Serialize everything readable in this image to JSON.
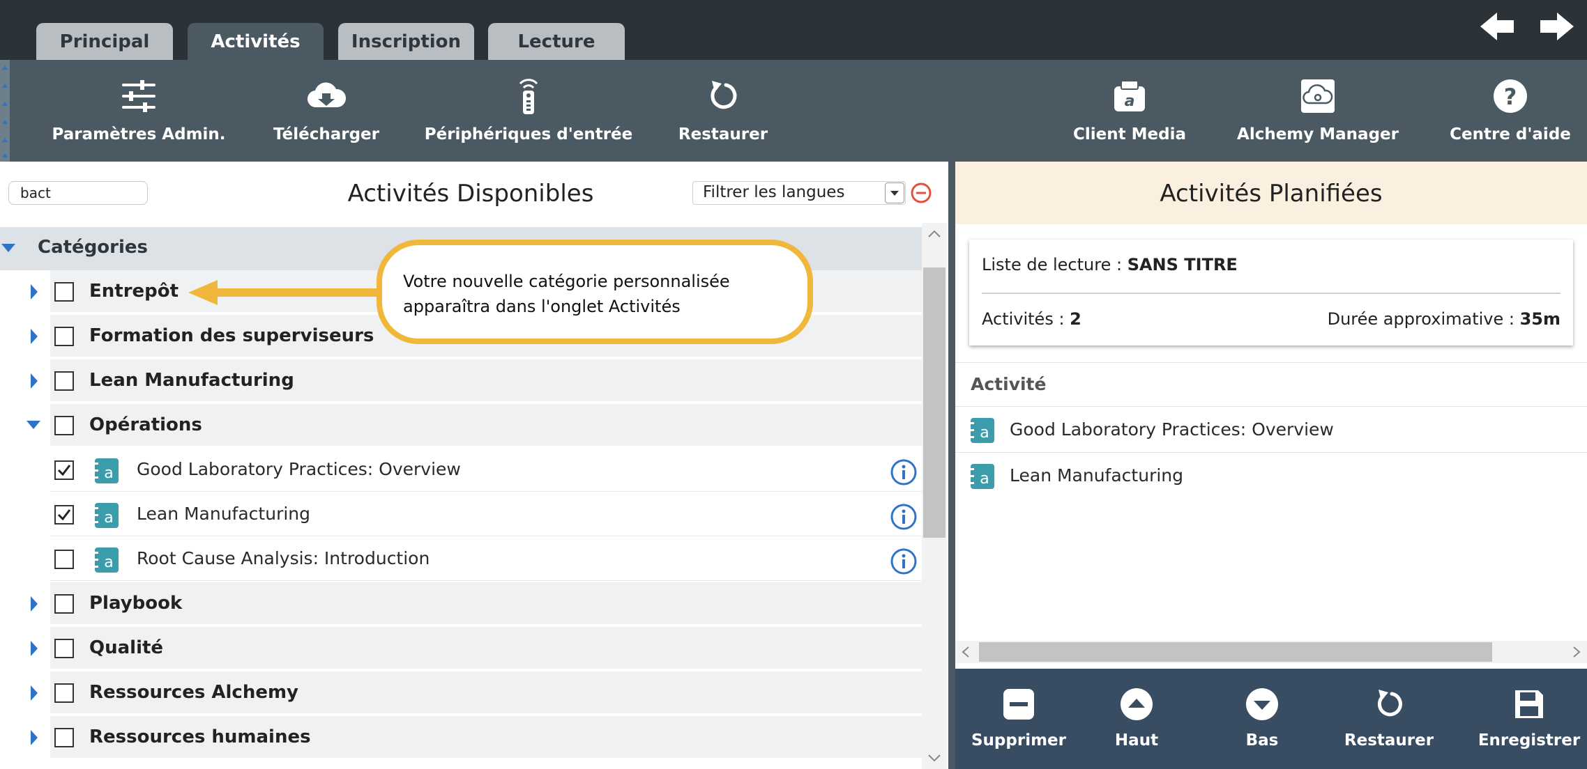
{
  "tabs": [
    {
      "label": "Principal",
      "active": false
    },
    {
      "label": "Activités",
      "active": true
    },
    {
      "label": "Inscription",
      "active": false
    },
    {
      "label": "Lecture",
      "active": false
    }
  ],
  "toolbar": {
    "admin": "Paramètres Admin.",
    "download": "Télécharger",
    "devices": "Périphériques d'entrée",
    "restore": "Restaurer",
    "media": "Client Media",
    "alchemy": "Alchemy Manager",
    "help": "Centre d'aide"
  },
  "available": {
    "title": "Activités Disponibles",
    "search_value": "bact",
    "language_filter": "Filtrer les langues",
    "categories_header": "Catégories",
    "rows": [
      {
        "label": "Entrepôt",
        "checked": false
      },
      {
        "label": "Formation des superviseurs",
        "checked": false
      },
      {
        "label": "Lean Manufacturing",
        "checked": false
      },
      {
        "label": "Opérations",
        "checked": false,
        "expanded": true
      },
      {
        "label": "Good Laboratory Practices: Overview",
        "checked": true,
        "child": true
      },
      {
        "label": "Lean Manufacturing",
        "checked": true,
        "child": true
      },
      {
        "label": "Root Cause Analysis: Introduction",
        "checked": false,
        "child": true
      },
      {
        "label": "Playbook",
        "checked": false
      },
      {
        "label": "Qualité",
        "checked": false
      },
      {
        "label": "Ressources Alchemy",
        "checked": false
      },
      {
        "label": "Ressources humaines",
        "checked": false
      }
    ]
  },
  "planned": {
    "title": "Activités Planifiées",
    "playlist_label": "Liste de lecture : ",
    "playlist_value": "SANS TITRE",
    "count_label": "Activités : ",
    "count_value": "2",
    "duration_label": "Durée approximative : ",
    "duration_value": "35m",
    "column_header": "Activité",
    "items": [
      "Good Laboratory Practices: Overview",
      "Lean Manufacturing"
    ]
  },
  "bottom_toolbar": {
    "delete": "Supprimer",
    "up": "Haut",
    "down": "Bas",
    "restore": "Restaurer",
    "save": "Enregistrer"
  },
  "callout": {
    "text": "Votre nouvelle catégorie personnalisée apparaîtra dans l'onglet Activités"
  },
  "colors": {
    "topbar": "#2b3339",
    "toolbar": "#4b5962",
    "bottombar": "#384d62",
    "accent_blue": "#2f73c8",
    "teal_icon": "#3b9cac",
    "callout_border": "#f0b73a",
    "planned_header_bg": "#fbf0df"
  }
}
